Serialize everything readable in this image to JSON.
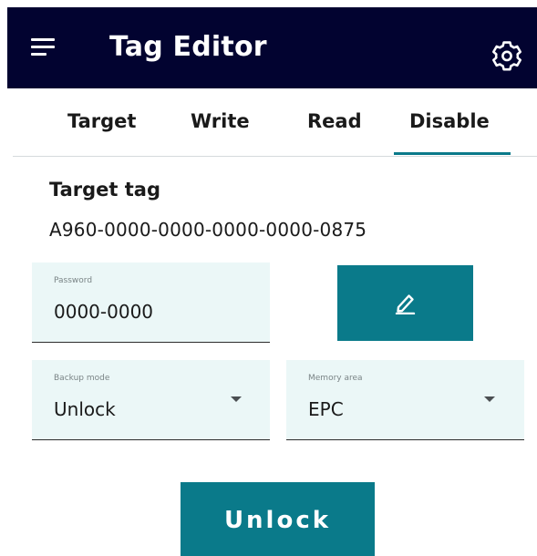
{
  "header": {
    "title": "Tag Editor",
    "menu_icon": "hamburger-menu-icon",
    "settings_icon": "gear-icon",
    "background": "#020330"
  },
  "tabs": [
    {
      "label": "Target",
      "active": false
    },
    {
      "label": "Write",
      "active": false
    },
    {
      "label": "Read",
      "active": false
    },
    {
      "label": "Disable",
      "active": true
    }
  ],
  "target": {
    "section_label": "Target tag",
    "tag_value": "A960-0000-0000-0000-0000-0875"
  },
  "password": {
    "label": "Password",
    "value": "0000-0000"
  },
  "edit_button": {
    "icon": "pencil-icon"
  },
  "backup_mode": {
    "label": "Backup mode",
    "value": "Unlock"
  },
  "memory_area": {
    "label": "Memory area",
    "value": "EPC"
  },
  "action_button": {
    "label": "Unlock"
  },
  "colors": {
    "accent": "#0a7a8a",
    "field_background": "#ebf7f7",
    "header": "#020330"
  }
}
